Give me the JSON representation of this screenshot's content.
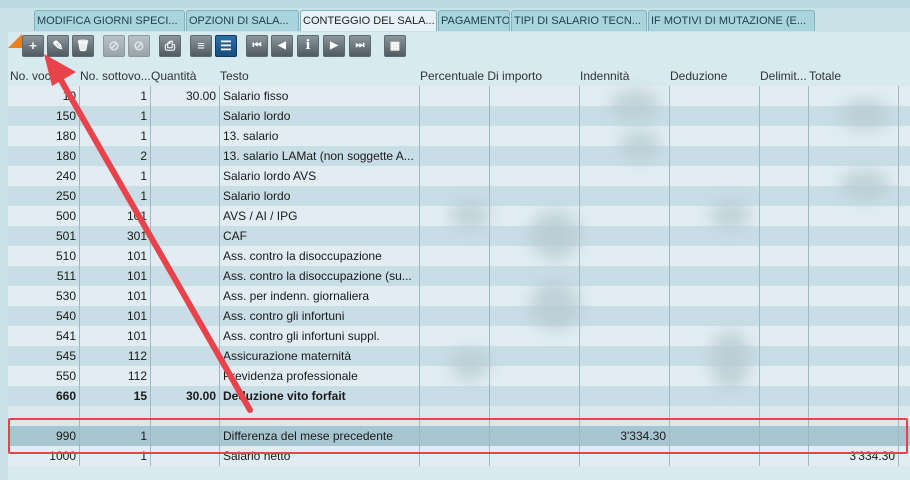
{
  "tabs": [
    {
      "label": "MODIFICA GIORNI SPECI...",
      "active": false
    },
    {
      "label": "OPZIONI DI SALA...",
      "active": false
    },
    {
      "label": "CONTEGGIO DEL SALA...",
      "active": true
    },
    {
      "label": "PAGAMENTO",
      "active": false
    },
    {
      "label": "TIPI DI SALARIO TECN...",
      "active": false
    },
    {
      "label": "IF MOTIVI DI MUTAZIONE (E...",
      "active": false
    }
  ],
  "toolbar": {
    "add_glyph": "+",
    "edit_glyph": "✎",
    "delete_glyph": "🗑",
    "disabled1_glyph": "⊘",
    "disabled2_glyph": "⊘",
    "print_glyph": "⎙",
    "form_glyph": "≡",
    "list_glyph": "☰",
    "first_glyph": "⏮",
    "prev_glyph": "◀",
    "info_glyph": "i",
    "next_glyph": "▶",
    "last_glyph": "⏭",
    "calc_glyph": "▦"
  },
  "grid": {
    "headers": {
      "no_voce": "No. voce",
      "no_sottovoce": "No. sottovo...",
      "quantita": "Quantità",
      "testo": "Testo",
      "percentuale": "Percentuale Di importo",
      "indennita": "Indennità",
      "deduzione": "Deduzione",
      "delimit": "Delimit...",
      "totale": "Totale"
    },
    "rows": [
      {
        "voce": "10",
        "sotto": "1",
        "qta": "30.00",
        "testo": "Salario fisso",
        "ind": "",
        "tot": ""
      },
      {
        "voce": "150",
        "sotto": "1",
        "qta": "",
        "testo": "Salario lordo",
        "ind": "",
        "tot": ""
      },
      {
        "voce": "180",
        "sotto": "1",
        "qta": "",
        "testo": "13. salario",
        "ind": "",
        "tot": ""
      },
      {
        "voce": "180",
        "sotto": "2",
        "qta": "",
        "testo": "13. salario LAMat (non soggette A...",
        "ind": "",
        "tot": ""
      },
      {
        "voce": "240",
        "sotto": "1",
        "qta": "",
        "testo": "Salario lordo AVS",
        "ind": "",
        "tot": ""
      },
      {
        "voce": "250",
        "sotto": "1",
        "qta": "",
        "testo": "Salario lordo",
        "ind": "",
        "tot": ""
      },
      {
        "voce": "500",
        "sotto": "101",
        "qta": "",
        "testo": "AVS / AI / IPG",
        "ind": "",
        "tot": ""
      },
      {
        "voce": "501",
        "sotto": "301",
        "qta": "",
        "testo": "CAF",
        "ind": "",
        "tot": ""
      },
      {
        "voce": "510",
        "sotto": "101",
        "qta": "",
        "testo": "Ass. contro la disoccupazione",
        "ind": "",
        "tot": ""
      },
      {
        "voce": "511",
        "sotto": "101",
        "qta": "",
        "testo": "Ass. contro la disoccupazione (su...",
        "ind": "",
        "tot": ""
      },
      {
        "voce": "530",
        "sotto": "101",
        "qta": "",
        "testo": "Ass. per indenn. giornaliera",
        "ind": "",
        "tot": ""
      },
      {
        "voce": "540",
        "sotto": "101",
        "qta": "",
        "testo": "Ass. contro gli infortuni",
        "ind": "",
        "tot": ""
      },
      {
        "voce": "541",
        "sotto": "101",
        "qta": "",
        "testo": "Ass. contro gli infortuni suppl.",
        "ind": "",
        "tot": ""
      },
      {
        "voce": "545",
        "sotto": "112",
        "qta": "",
        "testo": "Assicurazione maternità",
        "ind": "",
        "tot": ""
      },
      {
        "voce": "550",
        "sotto": "112",
        "qta": "",
        "testo": "Previdenza professionale",
        "ind": "",
        "tot": ""
      },
      {
        "voce": "660",
        "sotto": "15",
        "qta": "30.00",
        "testo": "Deduzione vito forfait",
        "ind": "",
        "tot": "",
        "bold": true
      },
      {
        "voce": "",
        "sotto": "",
        "qta": "",
        "testo": "",
        "ind": "",
        "tot": "",
        "gap": true
      },
      {
        "voce": "990",
        "sotto": "1",
        "qta": "",
        "testo": "Differenza del mese precedente",
        "ind": "3'334.30",
        "tot": "",
        "sel": true
      },
      {
        "voce": "1000",
        "sotto": "1",
        "qta": "",
        "testo": "Salario netto",
        "ind": "",
        "tot": "3'334.30"
      }
    ]
  },
  "colors": {
    "accent": "#e8434b",
    "orange": "#e8821f"
  }
}
